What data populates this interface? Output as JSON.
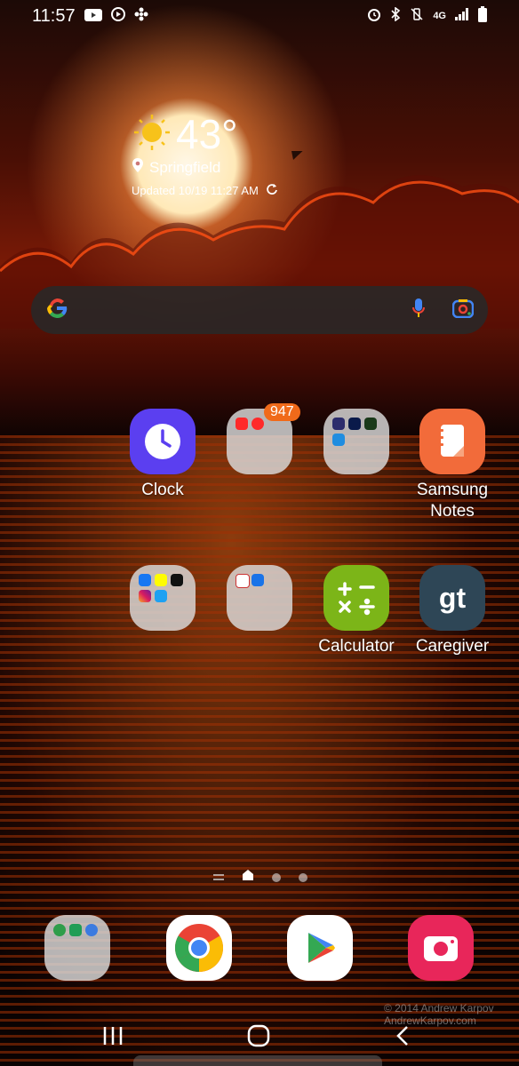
{
  "status_bar": {
    "time": "11:57",
    "network": "4G"
  },
  "weather": {
    "temperature": "43°",
    "location": "Springfield",
    "updated": "Updated 10/19 11:27 AM"
  },
  "apps": {
    "clock": {
      "label": "Clock"
    },
    "folder_youtube": {
      "label": "",
      "badge": "947"
    },
    "folder_streaming": {
      "label": ""
    },
    "samsung_notes": {
      "label_line1": "Samsung",
      "label_line2": "Notes"
    },
    "folder_social": {
      "label": ""
    },
    "folder_cbt": {
      "label": ""
    },
    "calculator": {
      "label": "Calculator"
    },
    "caregiver": {
      "label": "Caregiver",
      "icon_text": "gt"
    }
  },
  "credit": {
    "line1": "© 2014 Andrew Karpov",
    "line2": "AndrewKarpov.com"
  },
  "colors": {
    "clock_bg": "#5b3ff0",
    "notes_bg": "#f26b3a",
    "calculator_bg": "#7cb518",
    "caregiver_bg": "#2e4656",
    "camera_bg": "#e8265a"
  }
}
